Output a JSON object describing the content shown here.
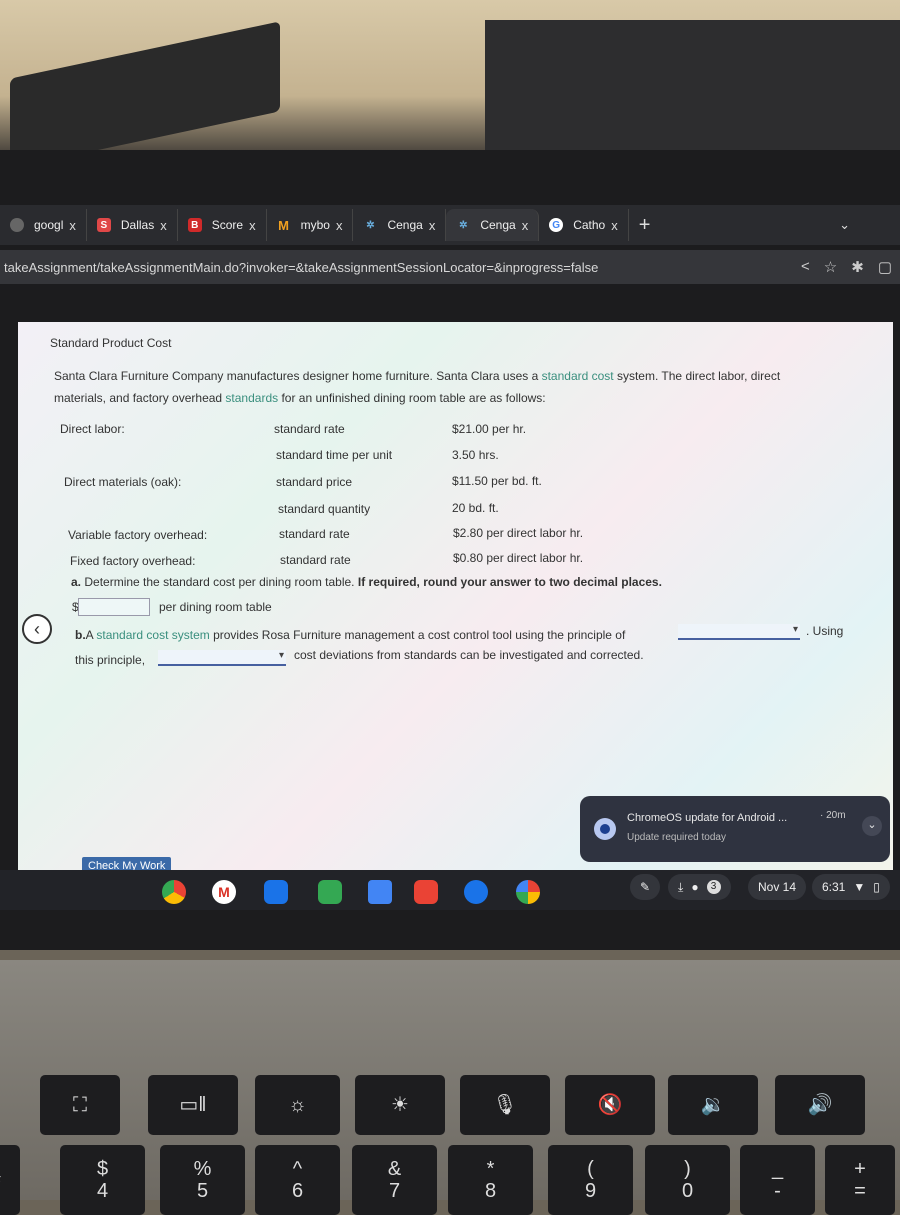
{
  "browser": {
    "tabs": [
      {
        "label": "googl",
        "icon": "globe-icon"
      },
      {
        "label": "Dallas",
        "icon": "s-logo-icon"
      },
      {
        "label": "Score",
        "icon": "b-logo-icon"
      },
      {
        "label": "mybo",
        "icon": "m-logo-icon"
      },
      {
        "label": "Cenga",
        "icon": "cengage-icon"
      },
      {
        "label": "Cenga",
        "icon": "cengage-icon",
        "active": true
      },
      {
        "label": "Catho",
        "icon": "google-icon"
      }
    ],
    "close_glyph": "x",
    "new_tab": "+",
    "url": "takeAssignment/takeAssignmentMain.do?invoker=&takeAssignmentSessionLocator=&inprogress=false"
  },
  "page": {
    "title": "Standard Product Cost",
    "intro1_a": "Santa Clara Furniture Company manufactures designer home furniture. Santa Clara uses a ",
    "intro1_link": "standard cost",
    "intro1_b": " system. The direct labor, direct",
    "intro2_a": "materials, and factory overhead ",
    "intro2_link": "standards",
    "intro2_b": " for an unfinished dining room table are as follows:",
    "rows": [
      {
        "category": "Direct labor:",
        "item": "standard rate",
        "value": "$21.00 per hr."
      },
      {
        "category": "",
        "item": "standard time per unit",
        "value": "3.50 hrs."
      },
      {
        "category": "Direct materials (oak):",
        "item": "standard price",
        "value": "$11.50 per bd. ft."
      },
      {
        "category": "",
        "item": "standard quantity",
        "value": "20 bd. ft."
      },
      {
        "category": "Variable factory overhead:",
        "item": "standard rate",
        "value": "$2.80 per direct labor hr."
      },
      {
        "category": "Fixed factory overhead:",
        "item": "standard rate",
        "value": "$0.80 per direct labor hr."
      }
    ],
    "qa_label": "a.",
    "qa_text": "Determine the standard cost per dining room table.",
    "qa_bold": "If required, round your answer to two decimal places.",
    "qa_currency": "$",
    "qa_value": "",
    "qa_suffix": "per dining room table",
    "qb_label": "b.",
    "qb_a": "A ",
    "qb_link": "standard cost system",
    "qb_b": " provides Rosa Furniture management a cost control tool using the principle of",
    "qb_c": ". Using",
    "qb_d": "this principle,",
    "qb_e": "cost deviations from standards can be investigated and corrected.",
    "select1": "",
    "select2": "",
    "check_button": "Check My Work"
  },
  "notification": {
    "title": "ChromeOS update for Android ...",
    "time": "· 20m",
    "body": "Update required today"
  },
  "shelf": {
    "date": "Nov 14",
    "time": "6:31",
    "badge": "3"
  },
  "keyboard": [
    {
      "top": "",
      "bottom": "#"
    },
    {
      "top": "$",
      "bottom": "4"
    },
    {
      "top": "%",
      "bottom": "5"
    },
    {
      "top": "^",
      "bottom": "6"
    },
    {
      "top": "&",
      "bottom": "7"
    },
    {
      "top": "*",
      "bottom": "8"
    },
    {
      "top": "(",
      "bottom": "9"
    },
    {
      "top": ")",
      "bottom": "0"
    },
    {
      "top": "_",
      "bottom": "-"
    },
    {
      "top": "+",
      "bottom": "="
    }
  ]
}
